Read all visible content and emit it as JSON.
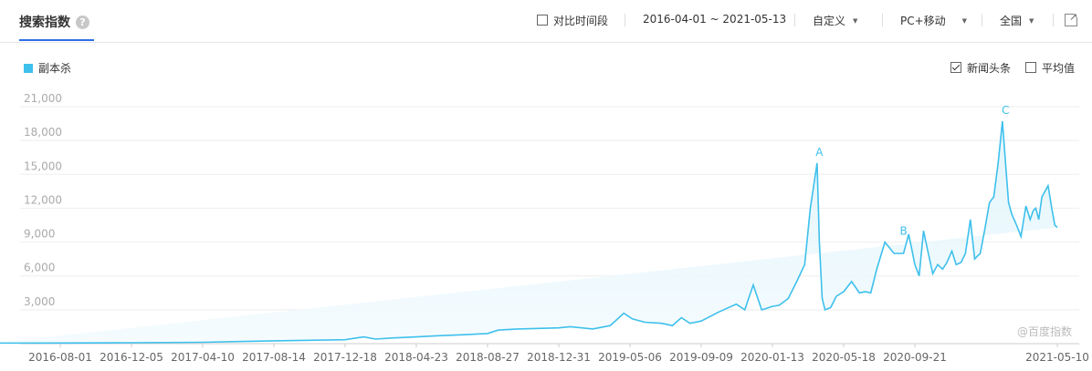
{
  "header": {
    "title": "搜索指数",
    "help_icon": "question-icon",
    "compare_label": "对比时间段",
    "date_range": "2016-04-01 ~ 2021-05-13",
    "custom_label": "自定义",
    "device_label": "PC+移动",
    "region_label": "全国",
    "share_icon": "external-link-icon"
  },
  "legend": {
    "series_name": "副本杀"
  },
  "options": {
    "news_label": "新闻头条",
    "average_label": "平均值"
  },
  "watermark": "@百度指数",
  "colors": {
    "line": "#3ec0ec",
    "accent": "#2e6ee6"
  },
  "chart_data": {
    "type": "area",
    "ylim": [
      0,
      21000
    ],
    "y_ticks": [
      "21,000",
      "18,000",
      "15,000",
      "12,000",
      "9,000",
      "6,000",
      "3,000"
    ],
    "y_tick_values": [
      21000,
      18000,
      15000,
      12000,
      9000,
      6000,
      3000
    ],
    "x_ticks": [
      "2016-08-01",
      "2016-12-05",
      "2017-04-10",
      "2017-08-14",
      "2017-12-18",
      "2018-04-23",
      "2018-08-27",
      "2018-12-31",
      "2019-05-06",
      "2019-09-09",
      "2020-01-13",
      "2020-05-18",
      "2020-09-21",
      "2021-05-10"
    ],
    "x": [
      "2016-04-01",
      "2016-08-01",
      "2016-12-05",
      "2017-04-10",
      "2017-08-14",
      "2017-10-15",
      "2017-12-18",
      "2018-01-20",
      "2018-02-10",
      "2018-03-10",
      "2018-04-23",
      "2018-06-01",
      "2018-07-20",
      "2018-08-27",
      "2018-09-15",
      "2018-10-20",
      "2018-12-31",
      "2019-01-20",
      "2019-03-01",
      "2019-04-01",
      "2019-04-25",
      "2019-05-10",
      "2019-06-01",
      "2019-07-01",
      "2019-07-20",
      "2019-08-05",
      "2019-08-20",
      "2019-09-09",
      "2019-10-10",
      "2019-11-10",
      "2019-11-25",
      "2019-12-10",
      "2019-12-25",
      "2020-01-01",
      "2020-01-13",
      "2020-01-25",
      "2020-02-10",
      "2020-02-25",
      "2020-03-10",
      "2020-03-20",
      "2020-04-01",
      "2020-04-05",
      "2020-04-10",
      "2020-04-15",
      "2020-04-25",
      "2020-05-05",
      "2020-05-18",
      "2020-06-01",
      "2020-06-15",
      "2020-06-25",
      "2020-07-05",
      "2020-07-15",
      "2020-07-30",
      "2020-08-15",
      "2020-09-01",
      "2020-09-10",
      "2020-09-15",
      "2020-09-21",
      "2020-09-28",
      "2020-10-05",
      "2020-10-12",
      "2020-10-20",
      "2020-10-28",
      "2020-11-05",
      "2020-11-12",
      "2020-11-20",
      "2020-11-27",
      "2020-12-05",
      "2020-12-12",
      "2020-12-20",
      "2020-12-27",
      "2021-01-05",
      "2021-01-12",
      "2021-01-20",
      "2021-01-27",
      "2021-02-03",
      "2021-02-10",
      "2021-02-15",
      "2021-02-20",
      "2021-02-25",
      "2021-03-05",
      "2021-03-12",
      "2021-03-20",
      "2021-03-27",
      "2021-04-01",
      "2021-04-05",
      "2021-04-10",
      "2021-04-15",
      "2021-04-20",
      "2021-04-25",
      "2021-05-01",
      "2021-05-06",
      "2021-05-10",
      "2021-05-13"
    ],
    "values": [
      50,
      60,
      80,
      120,
      250,
      300,
      350,
      600,
      400,
      500,
      600,
      700,
      800,
      900,
      1200,
      1300,
      1400,
      1500,
      1300,
      1600,
      2700,
      2200,
      1900,
      1800,
      1600,
      2300,
      1800,
      2000,
      2800,
      3500,
      3000,
      5200,
      3000,
      3100,
      3300,
      3400,
      4000,
      5500,
      7000,
      12000,
      16000,
      9000,
      4000,
      3000,
      3200,
      4200,
      4600,
      5500,
      4500,
      4600,
      4500,
      6500,
      9000,
      8000,
      8000,
      9700,
      8500,
      7000,
      6000,
      10000,
      8200,
      6200,
      7000,
      6600,
      7200,
      8200,
      7000,
      7200,
      8000,
      11000,
      7500,
      8000,
      10000,
      12500,
      13000,
      16000,
      19700,
      16000,
      12500,
      11500,
      10500,
      9500,
      12200,
      11000,
      11800,
      12000,
      11000,
      13000,
      13500,
      14000,
      12000,
      10500,
      10300
    ]
  },
  "annotations": [
    {
      "label": "A",
      "x": "2020-04-05",
      "y": 16000
    },
    {
      "label": "B",
      "x": "2020-09-01",
      "y": 9000
    },
    {
      "label": "C",
      "x": "2021-02-15",
      "y": 19700
    }
  ]
}
